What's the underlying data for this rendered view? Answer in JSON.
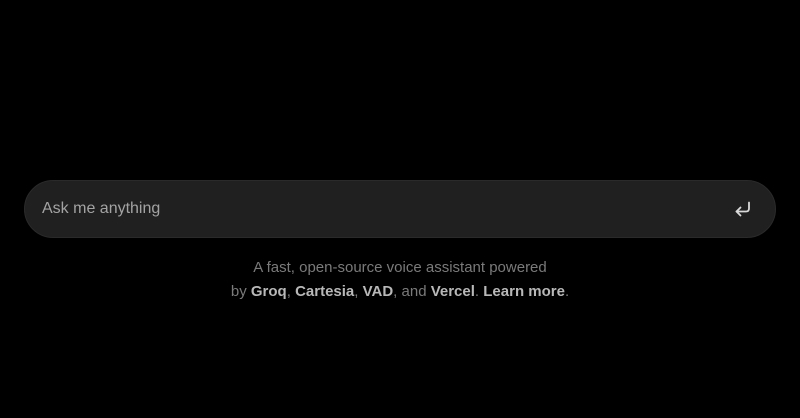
{
  "prompt": {
    "placeholder": "Ask me anything",
    "value": "",
    "submit_icon": "enter-return-icon"
  },
  "footer": {
    "line1": "A fast, open-source voice assistant powered",
    "by": "by ",
    "groq": "Groq",
    "sep1": ", ",
    "cartesia": "Cartesia",
    "sep2": ", ",
    "vad": "VAD",
    "sep3": ", and ",
    "vercel": "Vercel",
    "sep4": ". ",
    "learn_more": "Learn more",
    "end": "."
  },
  "colors": {
    "background": "#000000",
    "input_bg": "#202020",
    "placeholder": "#a3a3a3",
    "muted_text": "#7a7a7a",
    "highlight_text": "#b8b8b8",
    "icon": "#d9d9d9"
  }
}
